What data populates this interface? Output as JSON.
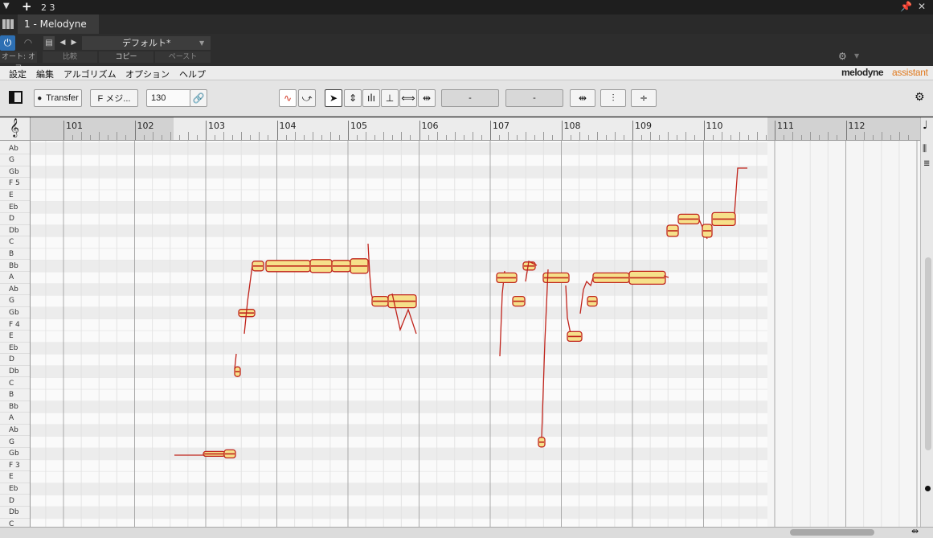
{
  "titlebar": {
    "menu_icon": "triangle-down-icon",
    "add_icon": "plus-icon",
    "count": "2 3",
    "pin_icon": "pin-icon"
  },
  "tab": {
    "label": "1 - Melodyne"
  },
  "control": {
    "preset": "デフォルト*",
    "auto": "オート: オフ",
    "compare": "比較",
    "copy": "コピー",
    "paste": "ペースト"
  },
  "menu": {
    "items": [
      "設定",
      "編集",
      "アルゴリズム",
      "オプション",
      "ヘルプ"
    ],
    "brand": "melodyne",
    "brand_edition": "assistant"
  },
  "toolbar": {
    "transfer": "Transfer",
    "key": "F メジ...",
    "tempo": "130",
    "field1": "-",
    "field2": "-"
  },
  "ruler": {
    "bars": [
      "101",
      "102",
      "103",
      "104",
      "105",
      "106",
      "107",
      "108",
      "109",
      "110",
      "111",
      "112"
    ]
  },
  "notes": [
    "Ab",
    "G",
    "Gb",
    "F 5",
    "E",
    "Eb",
    "D",
    "Db",
    "C",
    "B",
    "Bb",
    "A",
    "Ab",
    "G",
    "Gb",
    "F 4",
    "E",
    "Eb",
    "D",
    "Db",
    "C",
    "B",
    "Bb",
    "A",
    "Ab",
    "G",
    "Gb",
    "F 3",
    "E",
    "Eb",
    "D",
    "Db",
    "C"
  ],
  "colors": {
    "blob_fill": "#f6e08a",
    "blob_edge": "#c0231b",
    "pitch_line": "#c0231b",
    "accent": "#e07a1f"
  }
}
